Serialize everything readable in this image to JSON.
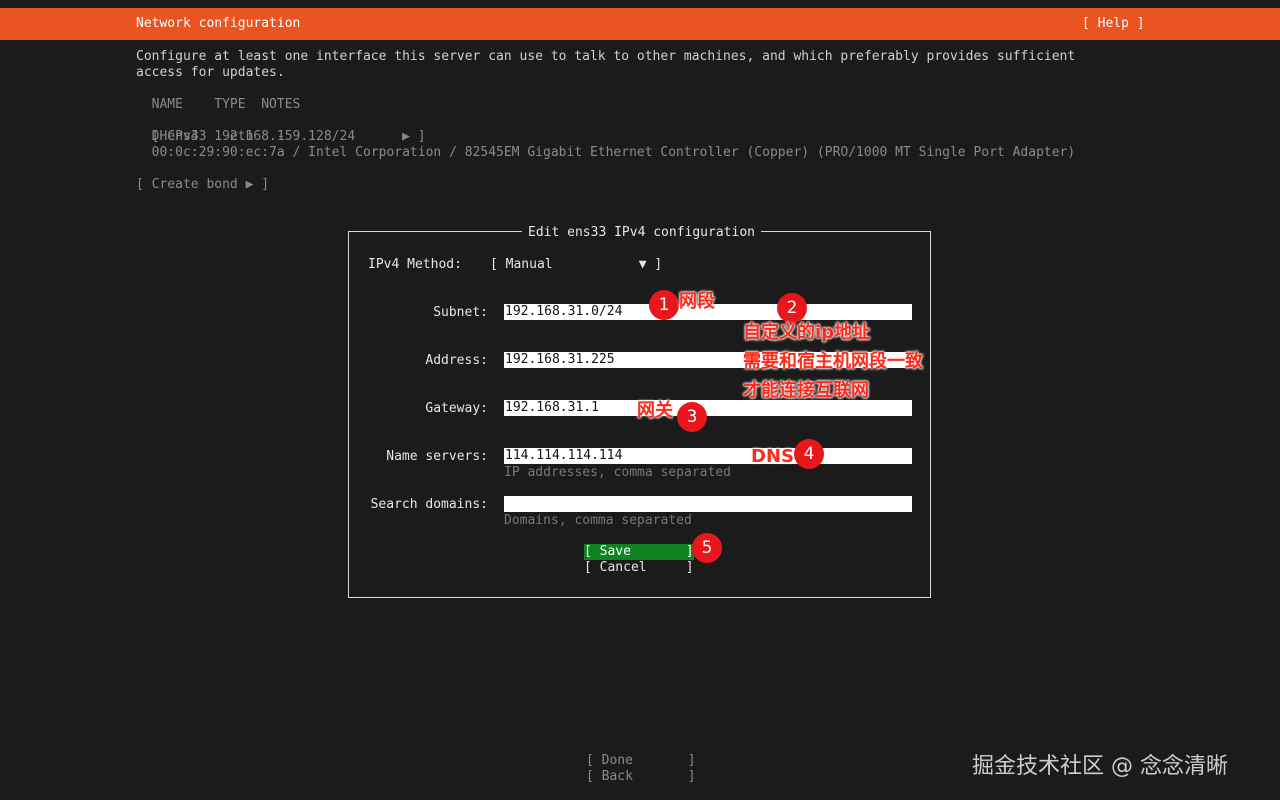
{
  "header": {
    "title": "Network configuration",
    "help": "[ Help ]"
  },
  "intro": {
    "line1": "Configure at least one interface this server can use to talk to other machines, and which preferably provides sufficient",
    "line2": "access for updates."
  },
  "table": {
    "headers": "  NAME    TYPE  NOTES",
    "row_bracket_open": "[",
    "row_main": " ens33   eth   -               ▶ ]",
    "dhcp": "  DHCPv4  192.168.159.128/24",
    "hw": "  00:0c:29:90:ec:7a / Intel Corporation / 82545EM Gigabit Ethernet Controller (Copper) (PRO/1000 MT Single Port Adapter)"
  },
  "create_bond": "[ Create bond ▶ ]",
  "dialog": {
    "title": "Edit ens33 IPv4 configuration",
    "method_label": "IPv4 Method:",
    "method_value": "[ Manual           ▼ ]",
    "fields": {
      "subnet": {
        "label": "Subnet:",
        "value": "192.168.31.0/24"
      },
      "address": {
        "label": "Address:",
        "value": "192.168.31.225"
      },
      "gateway": {
        "label": "Gateway:",
        "value": "192.168.31.1"
      },
      "nameservers": {
        "label": "Name servers:",
        "value": "114.114.114.114",
        "hint": "IP addresses, comma separated"
      },
      "search": {
        "label": "Search domains:",
        "value": "",
        "hint": "Domains, comma separated"
      }
    },
    "save": "[ Save       ]",
    "cancel": "[ Cancel     ]"
  },
  "footer": {
    "done": "[ Done       ]",
    "back": "[ Back       ]"
  },
  "annotations": {
    "b1": "1",
    "b2": "2",
    "b3": "3",
    "b4": "4",
    "b5": "5",
    "t1": "网段",
    "t2_line1": "自定义的ip地址",
    "t2_line2": "需要和宿主机网段一致",
    "t2_line3": "才能连接互联网",
    "t3": "网关",
    "t4": "DNS"
  },
  "watermark": "掘金技术社区 @ 念念清晰",
  "colors": {
    "header_bg": "#e95420",
    "save_bg": "#0e8420",
    "annotation": "#e8171b"
  }
}
